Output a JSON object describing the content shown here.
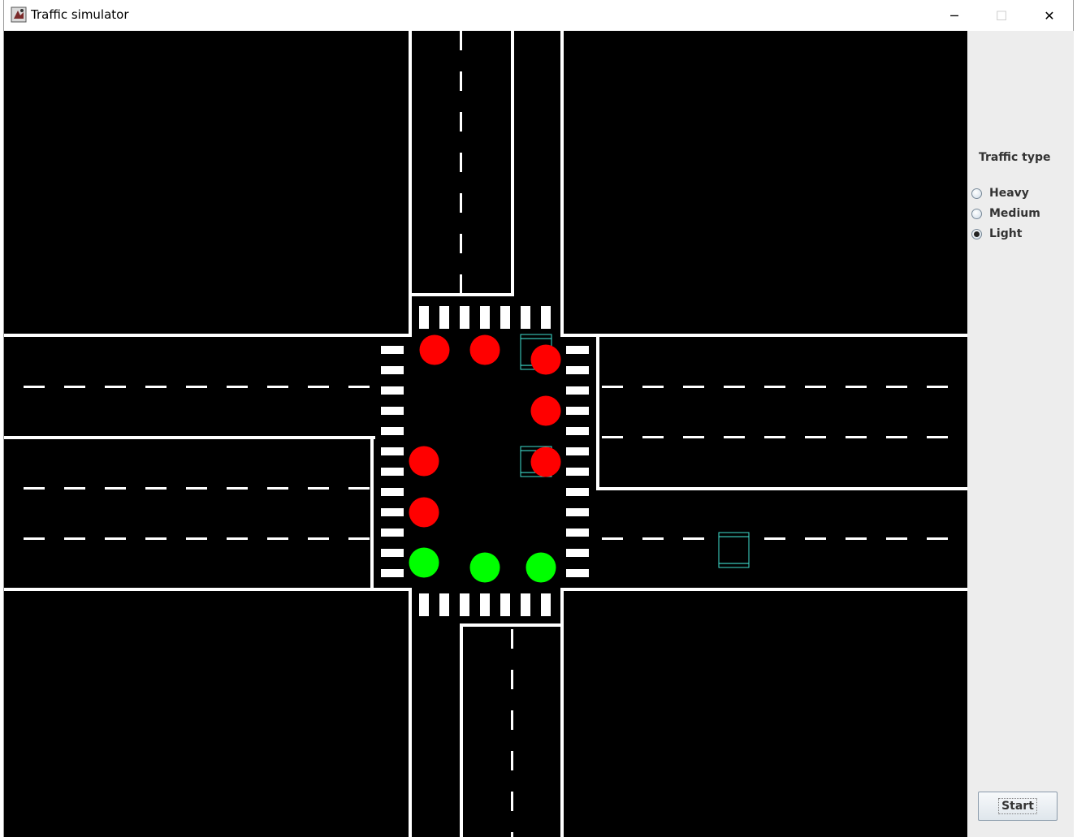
{
  "window": {
    "title": "Traffic simulator",
    "icon": "java-app-icon",
    "controls": {
      "minimize": "─",
      "maximize": "☐",
      "close": "✕"
    }
  },
  "side_panel": {
    "heading": "Traffic type",
    "options": [
      {
        "label": "Heavy",
        "checked": false
      },
      {
        "label": "Medium",
        "checked": false
      },
      {
        "label": "Light",
        "checked": true
      }
    ],
    "start_label": "Start"
  },
  "simulation": {
    "colors": {
      "background": "#000000",
      "road_lines": "#ffffff",
      "red_light": "#ff0000",
      "green_light": "#00ff00",
      "car_outline": "#40e0d0"
    },
    "lights": [
      {
        "id": "light-1",
        "state": "red"
      },
      {
        "id": "light-2",
        "state": "red"
      },
      {
        "id": "light-3",
        "state": "red"
      },
      {
        "id": "light-4",
        "state": "red"
      },
      {
        "id": "light-5",
        "state": "red"
      },
      {
        "id": "light-6",
        "state": "red"
      },
      {
        "id": "light-7",
        "state": "red"
      },
      {
        "id": "light-8",
        "state": "green"
      },
      {
        "id": "light-9",
        "state": "green"
      },
      {
        "id": "light-10",
        "state": "green"
      }
    ],
    "car_count": 3
  }
}
